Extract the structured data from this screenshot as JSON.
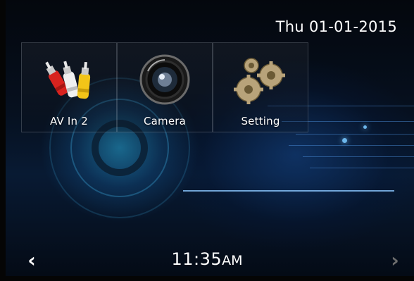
{
  "status": {
    "date": "Thu 01-01-2015"
  },
  "apps": [
    {
      "label": "AV In 2",
      "icon": "av-cables-icon"
    },
    {
      "label": "Camera",
      "icon": "camera-lens-icon"
    },
    {
      "label": "Setting",
      "icon": "gears-icon"
    }
  ],
  "clock": {
    "time": "11:35",
    "meridiem": "AM"
  },
  "navigation": {
    "prev_glyph": "‹",
    "next_glyph": "›"
  },
  "colors": {
    "text": "#ffffff",
    "accent": "#3fa9e0",
    "disabled_arrow": "#6e6e6e"
  }
}
